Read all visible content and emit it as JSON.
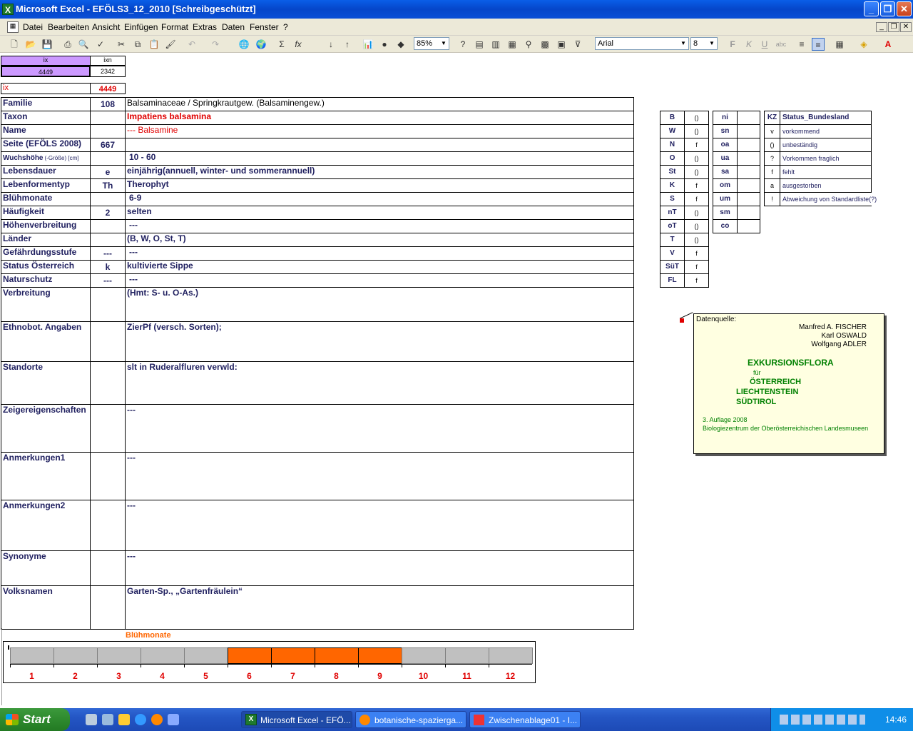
{
  "window": {
    "title": "Microsoft Excel - EFÖLS3_12_2010  [Schreibgeschützt]"
  },
  "menu": [
    "Datei",
    "Bearbeiten",
    "Ansicht",
    "Einfügen",
    "Format",
    "Extras",
    "Daten",
    "Fenster",
    "?"
  ],
  "toolbar": {
    "zoom": "85%",
    "font": "Arial",
    "font_size": "8"
  },
  "index": {
    "ix_header": "ix",
    "ixn_header": "ixn",
    "ix_value": "4449",
    "ixn_value": "2342",
    "ix_label": "ix",
    "ix_red_value": "4449"
  },
  "fields": [
    {
      "label": "Familie",
      "code": "108",
      "value": "Balsaminaceae  /  Springkrautgew. (Balsaminengew.)"
    },
    {
      "label": "Taxon",
      "code": "",
      "value": "Impatiens balsamina"
    },
    {
      "label": "Name",
      "code": "",
      "value": "--- Balsamine"
    },
    {
      "label": "Seite (EFÖLS 2008)",
      "code": "667",
      "value": ""
    },
    {
      "label": "Wuchshöhe",
      "label_suffix": "(-Größe) [cm]",
      "code": "",
      "value": "10 - 60"
    },
    {
      "label": "Lebensdauer",
      "code": "e",
      "value": "einjährig(annuell, winter- und sommerannuell)"
    },
    {
      "label": "Lebenformentyp",
      "code": "Th",
      "value": "Therophyt"
    },
    {
      "label": "Blühmonate",
      "code": "",
      "value": "6-9"
    },
    {
      "label": "Häufigkeit",
      "code": "2",
      "value": "selten"
    },
    {
      "label": "Höhenverbreitung",
      "code": "",
      "value": "---"
    },
    {
      "label": "Länder",
      "code": "",
      "value": "(B, W, O, St, T)"
    },
    {
      "label": "Gefährdungsstufe",
      "code": "---",
      "value": "---"
    },
    {
      "label": "Status Österreich",
      "code": "k",
      "value": "kultivierte Sippe"
    },
    {
      "label": "Naturschutz",
      "code": "---",
      "value": "---"
    },
    {
      "label": "Verbreitung",
      "code": "",
      "value": "(Hmt: S- u. O-As.)"
    },
    {
      "label": "Ethnobot. Angaben",
      "code": "",
      "value": "ZierPf (versch. Sorten);"
    },
    {
      "label": "Standorte",
      "code": "",
      "value": "slt in Ruderalfluren verwld:"
    },
    {
      "label": "Zeigereigenschaften",
      "code": "",
      "value": "---"
    },
    {
      "label": "Anmerkungen1",
      "code": "",
      "value": "---"
    },
    {
      "label": "Anmerkungen2",
      "code": "",
      "value": "---"
    },
    {
      "label": "Synonyme",
      "code": "",
      "value": "---"
    },
    {
      "label": "Volksnamen",
      "code": "",
      "value": "Garten-Sp., „Gartenfräulein“"
    }
  ],
  "bundeslaender": [
    {
      "k": "B",
      "v": "()"
    },
    {
      "k": "W",
      "v": "()"
    },
    {
      "k": "N",
      "v": "f"
    },
    {
      "k": "O",
      "v": "()"
    },
    {
      "k": "St",
      "v": "()"
    },
    {
      "k": "K",
      "v": "f"
    },
    {
      "k": "S",
      "v": "f"
    },
    {
      "k": "nT",
      "v": "()"
    },
    {
      "k": "oT",
      "v": "()"
    },
    {
      "k": "T",
      "v": "()"
    },
    {
      "k": "V",
      "v": "f"
    },
    {
      "k": "SüT",
      "v": "f"
    },
    {
      "k": "FL",
      "v": "f"
    }
  ],
  "regions": [
    "ni",
    "sn",
    "oa",
    "ua",
    "sa",
    "om",
    "um",
    "sm",
    "co"
  ],
  "status_legend": {
    "header_kz": "KZ",
    "header_label": "Status_Bundesland",
    "rows": [
      {
        "k": "v",
        "v": "vorkommend"
      },
      {
        "k": "()",
        "v": "unbeständig"
      },
      {
        "k": "?",
        "v": "Vorkommen fraglich"
      },
      {
        "k": "f",
        "v": "fehlt"
      },
      {
        "k": "a",
        "v": "ausgestorben"
      },
      {
        "k": "!",
        "v": "Abweichung von Standardliste(?)"
      }
    ]
  },
  "note": {
    "source_label": "Datenquelle:",
    "authors": [
      "Manfred A. FISCHER",
      "Karl OSWALD",
      "Wolfgang ADLER"
    ],
    "title1": "EXKURSIONSFLORA",
    "fuer": "für",
    "countries": [
      "ÖSTERREICH",
      "LIECHTENSTEIN",
      "SÜDTIROL"
    ],
    "edition": "3. Auflage 2008",
    "publisher": "Biologiezentrum der Oberösterreichischen Landesmuseen"
  },
  "bloom": {
    "title": "Blühmonate",
    "months": [
      "1",
      "2",
      "3",
      "4",
      "5",
      "6",
      "7",
      "8",
      "9",
      "10",
      "11",
      "12"
    ],
    "active_from": 6,
    "active_to": 9,
    "active_color": "#ff6600",
    "inactive_color": "#c0c0c0"
  },
  "taskbar": {
    "start": "Start",
    "tasks": [
      "Microsoft Excel - EFÖ...",
      "botanische-spazierga...",
      "Zwischenablage01 - I..."
    ],
    "clock": "14:46"
  }
}
